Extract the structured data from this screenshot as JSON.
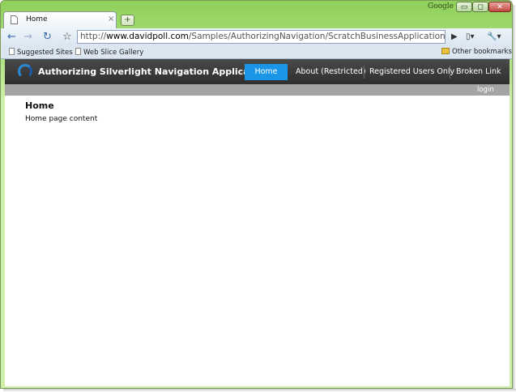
{
  "window": {
    "google_label": "Google",
    "minimize_glyph": "▭",
    "maximize_glyph": "◻",
    "close_glyph": "✕"
  },
  "tab": {
    "title": "Home",
    "close_glyph": "×",
    "new_tab_glyph": "+"
  },
  "toolbar": {
    "back_glyph": "←",
    "forward_glyph": "→",
    "reload_glyph": "↻",
    "star_glyph": "☆",
    "url_scheme": "http://",
    "url_host": "www.davidpoll.com",
    "url_path": "/Samples/AuthorizingNavigation/ScratchBusinessApplicationTestPage.as",
    "go_glyph": "▶",
    "page_menu_glyph": "▯▾",
    "wrench_menu_glyph": "🔧▾"
  },
  "bookmarks": {
    "items": [
      {
        "label": "Suggested Sites"
      },
      {
        "label": "Web Slice Gallery"
      }
    ],
    "other": "Other bookmarks"
  },
  "app": {
    "title": "Authorizing Silverlight Navigation Application",
    "nav": [
      {
        "label": "Home",
        "active": true
      },
      {
        "label": "About (Restricted)",
        "active": false
      },
      {
        "label": "Registered Users Only",
        "active": false
      },
      {
        "label": "Broken Link",
        "active": false
      }
    ],
    "login_label": "login",
    "accent_color": "#1a96e8"
  },
  "page": {
    "heading": "Home",
    "text": "Home page content"
  },
  "colors": {
    "frame_green": "#8fcf5a",
    "app_bar": "#3a3a3a",
    "status_bar": "#a4a4a4"
  }
}
